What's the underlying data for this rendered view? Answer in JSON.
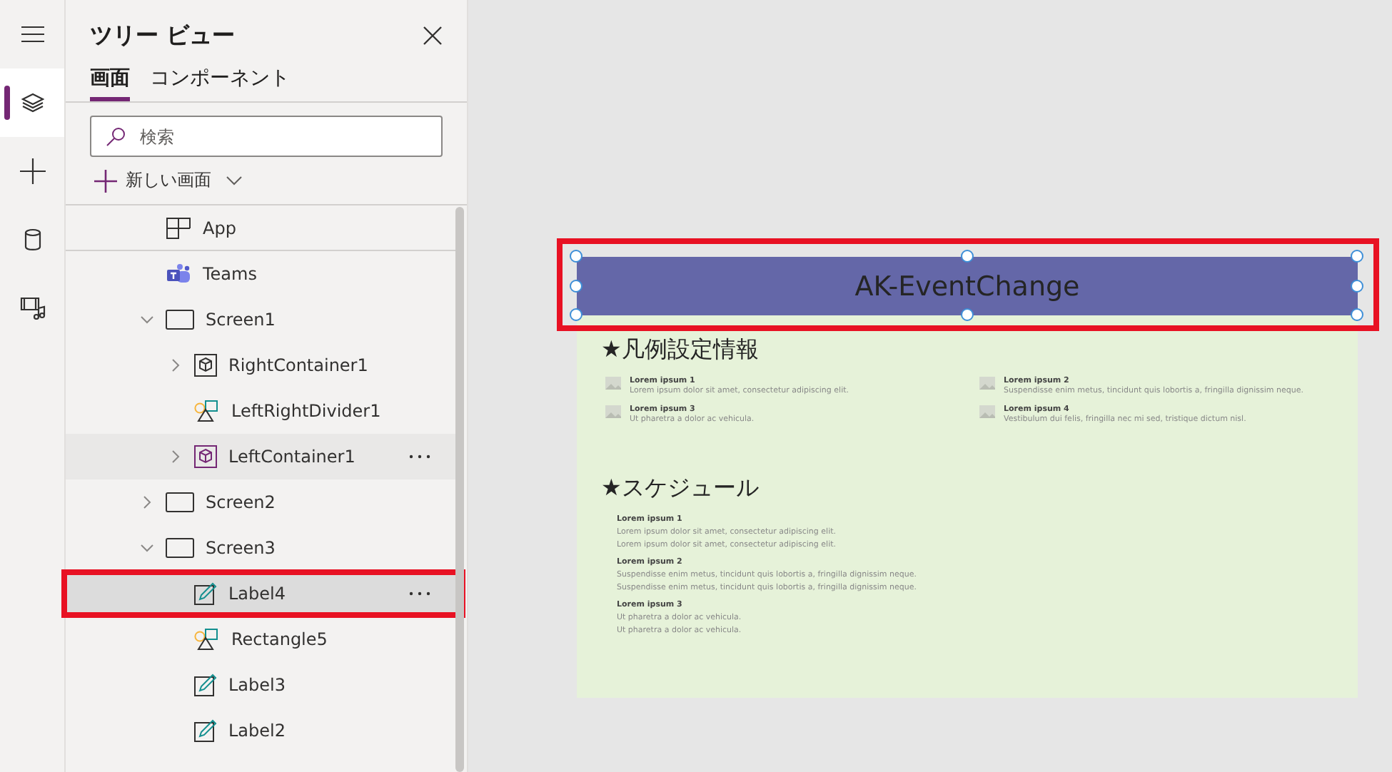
{
  "rail": [
    {
      "kind": "menu",
      "selected": false
    },
    {
      "kind": "layers",
      "selected": true
    },
    {
      "kind": "add",
      "selected": false
    },
    {
      "kind": "data",
      "selected": false
    },
    {
      "kind": "media",
      "selected": false
    }
  ],
  "panel": {
    "title": "ツリー ビュー",
    "tabs": [
      {
        "label": "画面",
        "selected": true
      },
      {
        "label": "コンポーネント",
        "selected": false
      }
    ],
    "search": {
      "placeholder": "検索"
    },
    "new_screen": "新しい画面",
    "tree": [
      {
        "label": "App",
        "kind": "app",
        "selected": false,
        "hovered": false,
        "highlighted": false
      },
      {
        "label": "Teams",
        "kind": "teams",
        "selected": false,
        "hovered": false,
        "highlighted": false
      },
      {
        "label": "Screen1",
        "kind": "screen",
        "expanded": true,
        "selected": false,
        "hovered": false,
        "highlighted": false,
        "children": [
          {
            "label": "RightContainer1",
            "kind": "container",
            "expanded": false,
            "selected": false,
            "hovered": false,
            "highlighted": false
          },
          {
            "label": "LeftRightDivider1",
            "kind": "shape",
            "selected": false,
            "hovered": false,
            "highlighted": false
          },
          {
            "label": "LeftContainer1",
            "kind": "container-active",
            "expanded": false,
            "selected": false,
            "hovered": true,
            "highlighted": false
          }
        ]
      },
      {
        "label": "Screen2",
        "kind": "screen",
        "expanded": false,
        "selected": false,
        "hovered": false,
        "highlighted": false
      },
      {
        "label": "Screen3",
        "kind": "screen",
        "expanded": true,
        "selected": false,
        "hovered": false,
        "highlighted": false,
        "children": [
          {
            "label": "Label4",
            "kind": "label",
            "selected": true,
            "hovered": true,
            "highlighted": true
          },
          {
            "label": "Rectangle5",
            "kind": "shape",
            "selected": false,
            "hovered": false,
            "highlighted": false
          },
          {
            "label": "Label3",
            "kind": "label",
            "selected": false,
            "hovered": false,
            "highlighted": false
          },
          {
            "label": "Label2",
            "kind": "label",
            "selected": false,
            "hovered": false,
            "highlighted": false
          }
        ]
      }
    ]
  },
  "canvas": {
    "header": {
      "text": "AK-EventChange",
      "selected": true,
      "highlighted": true
    },
    "legend": {
      "title": "★凡例設定情報",
      "items": [
        {
          "title": "Lorem ipsum 1",
          "text": "Lorem ipsum dolor sit amet, consectetur adipiscing elit."
        },
        {
          "title": "Lorem ipsum 2",
          "text": "Suspendisse enim metus, tincidunt quis lobortis a, fringilla dignissim neque."
        },
        {
          "title": "Lorem ipsum 3",
          "text": "Ut pharetra a dolor ac vehicula."
        },
        {
          "title": "Lorem ipsum 4",
          "text": "Vestibulum dui felis, fringilla nec mi sed, tristique dictum nisl."
        }
      ]
    },
    "schedule": {
      "title": "★スケジュール",
      "items": [
        {
          "title": "Lorem ipsum 1",
          "lines": [
            "Lorem ipsum dolor sit amet, consectetur adipiscing elit.",
            "Lorem ipsum dolor sit amet, consectetur adipiscing elit."
          ]
        },
        {
          "title": "Lorem ipsum 2",
          "lines": [
            "Suspendisse enim metus, tincidunt quis lobortis a, fringilla dignissim neque.",
            "Suspendisse enim metus, tincidunt quis lobortis a, fringilla dignissim neque."
          ]
        },
        {
          "title": "Lorem ipsum 3",
          "lines": [
            "Ut pharetra a dolor ac vehicula.",
            "Ut pharetra a dolor ac vehicula."
          ]
        }
      ]
    }
  }
}
